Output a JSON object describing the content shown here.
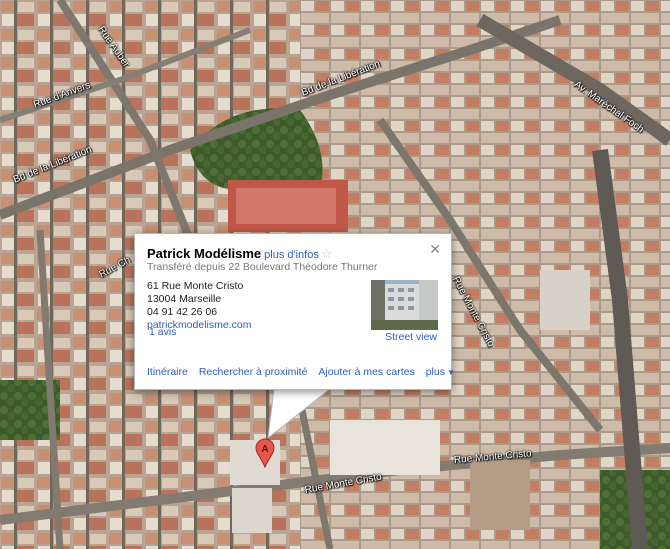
{
  "map": {
    "streets": [
      {
        "name": "Bd de la Libération",
        "key": "bd_liberation_west"
      },
      {
        "name": "Bd de la Libération",
        "key": "bd_liberation_east"
      },
      {
        "name": "Rue d'Anvers",
        "key": "rue_anvers"
      },
      {
        "name": "Rue Auber",
        "key": "rue_auber"
      },
      {
        "name": "Rue Ch",
        "key": "rue_ch"
      },
      {
        "name": "Av. Maréchal Foch",
        "key": "av_foch"
      },
      {
        "name": "Rue Monte Cristo",
        "key": "rue_monte_cristo_low"
      },
      {
        "name": "Rue Monte Cristo",
        "key": "rue_monte_cristo_right"
      },
      {
        "name": "Rue Monte Cristo",
        "key": "rue_monte_cristo_diag"
      }
    ],
    "marker_label": "A"
  },
  "info_window": {
    "title": "Patrick Modélisme",
    "more_info": "plus d'infos",
    "subtitle": "Transféré depuis 22 Boulevard Théodore Thurner",
    "address_line1": "61 Rue Monte Cristo",
    "address_line2": "13004 Marseille",
    "phone": "04 91 42 26 06",
    "website": "patrickmodelisme.com",
    "reviews": "1 avis",
    "street_view": "Street view",
    "actions": {
      "itinerary": "Itinéraire",
      "search_nearby": "Rechercher à proximité",
      "add_to_maps": "Ajouter à mes cartes",
      "more": "plus"
    }
  }
}
